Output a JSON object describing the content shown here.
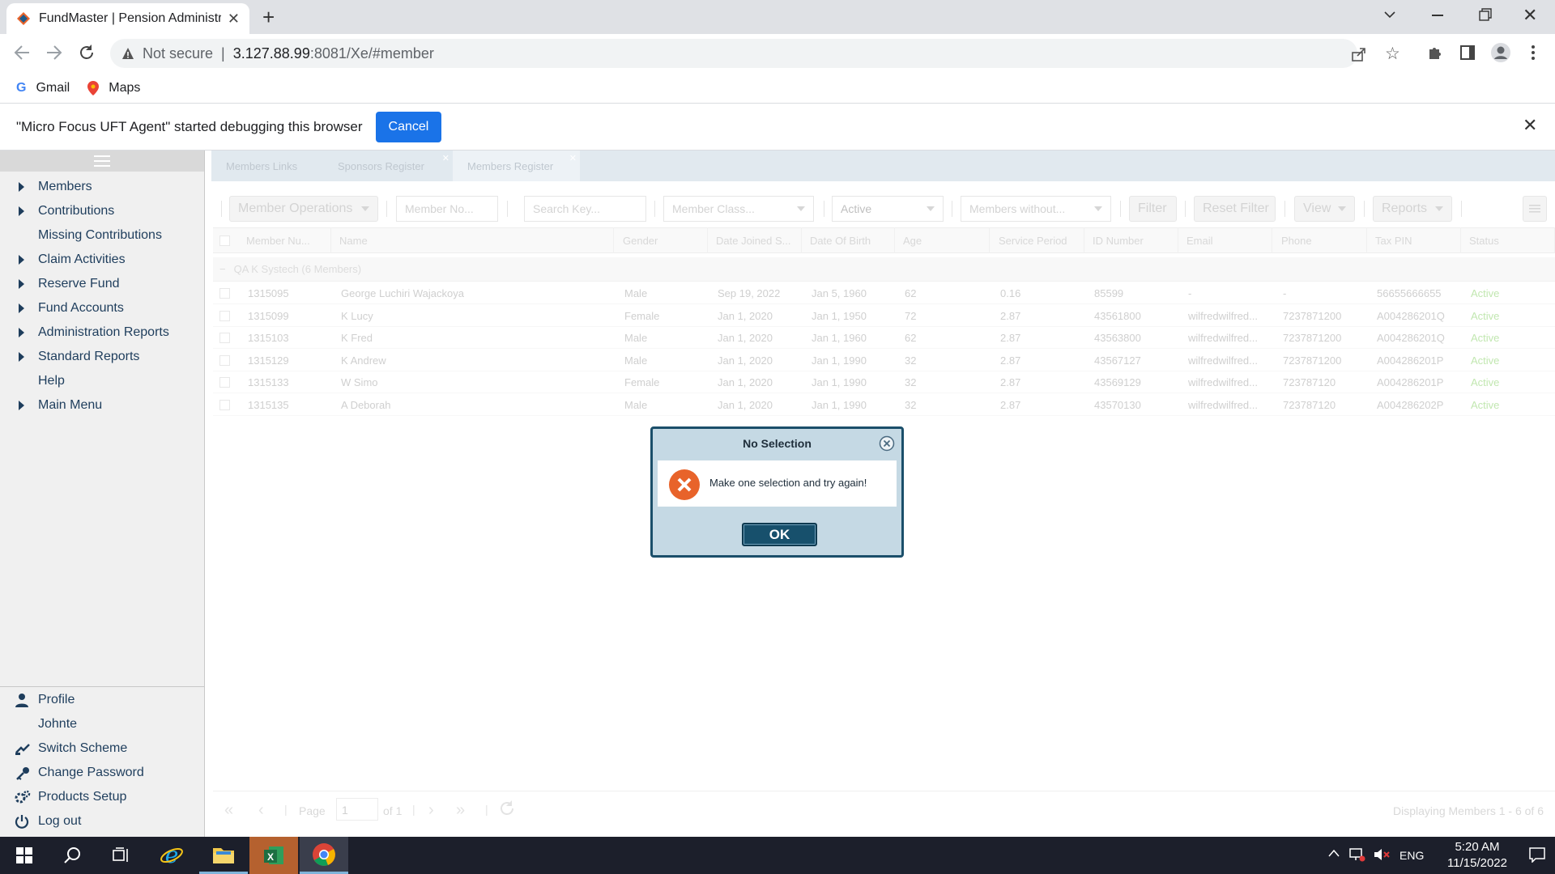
{
  "browser": {
    "tab_title": "FundMaster | Pension Administra",
    "not_secure": "Not secure",
    "url_host": "3.127.88.99",
    "url_rest": ":8081/Xe/#member",
    "bookmarks": [
      "Gmail",
      "Maps"
    ],
    "infobar_text": "\"Micro Focus UFT Agent\" started debugging this browser",
    "infobar_cancel": "Cancel"
  },
  "sidebar": {
    "items": [
      {
        "label": "Members",
        "expandable": true
      },
      {
        "label": "Contributions",
        "expandable": true
      },
      {
        "label": "Missing Contributions",
        "expandable": false
      },
      {
        "label": "Claim Activities",
        "expandable": true
      },
      {
        "label": "Reserve Fund",
        "expandable": true
      },
      {
        "label": "Fund Accounts",
        "expandable": true
      },
      {
        "label": "Administration Reports",
        "expandable": true
      },
      {
        "label": "Standard Reports",
        "expandable": true
      },
      {
        "label": "Help",
        "expandable": false
      },
      {
        "label": "Main Menu",
        "expandable": true
      }
    ],
    "bottom": {
      "profile": "Profile",
      "username": "Johnte",
      "switch_scheme": "Switch Scheme",
      "change_password": "Change Password",
      "products_setup": "Products Setup",
      "logout": "Log out"
    }
  },
  "tabs": [
    "Members Links",
    "Sponsors Register",
    "Members Register"
  ],
  "toolbar": {
    "member_operations": "Member Operations",
    "member_no_placeholder": "Member No...",
    "search_placeholder": "Search Key...",
    "member_class_placeholder": "Member Class...",
    "status_value": "Active",
    "members_without_placeholder": "Members without...",
    "filter": "Filter",
    "reset_filter": "Reset Filter",
    "view": "View",
    "reports": "Reports"
  },
  "table": {
    "columns": [
      "Member Nu...",
      "Name",
      "Gender",
      "Date Joined S...",
      "Date Of Birth",
      "Age",
      "Service Period",
      "ID Number",
      "Email",
      "Phone",
      "Tax PIN",
      "Status"
    ],
    "group_label": "QA K Systech (6 Members)",
    "rows": [
      [
        "1315095",
        "George Luchiri Wajackoya",
        "Male",
        "Sep 19, 2022",
        "Jan 5, 1960",
        "62",
        "0.16",
        "85599",
        "-",
        "-",
        "56655666655",
        "Active"
      ],
      [
        "1315099",
        "K Lucy",
        "Female",
        "Jan 1, 2020",
        "Jan 1, 1950",
        "72",
        "2.87",
        "43561800",
        "wilfredwilfred...",
        "7237871200",
        "A004286201Q",
        "Active"
      ],
      [
        "1315103",
        "K Fred",
        "Male",
        "Jan 1, 2020",
        "Jan 1, 1960",
        "62",
        "2.87",
        "43563800",
        "wilfredwilfred...",
        "7237871200",
        "A004286201Q",
        "Active"
      ],
      [
        "1315129",
        "K Andrew",
        "Male",
        "Jan 1, 2020",
        "Jan 1, 1990",
        "32",
        "2.87",
        "43567127",
        "wilfredwilfred...",
        "7237871200",
        "A004286201P",
        "Active"
      ],
      [
        "1315133",
        "W Simo",
        "Female",
        "Jan 1, 2020",
        "Jan 1, 1990",
        "32",
        "2.87",
        "43569129",
        "wilfredwilfred...",
        "723787120",
        "A004286201P",
        "Active"
      ],
      [
        "1315135",
        "A Deborah",
        "Male",
        "Jan 1, 2020",
        "Jan 1, 1990",
        "32",
        "2.87",
        "43570130",
        "wilfredwilfred...",
        "723787120",
        "A004286202P",
        "Active"
      ]
    ]
  },
  "pager": {
    "page_label": "Page",
    "page_value": "1",
    "of_label": "of 1",
    "display_text": "Displaying Members 1 - 6 of 6"
  },
  "dialog": {
    "title": "No Selection",
    "message": "Make one selection and try again!",
    "ok": "OK"
  },
  "taskbar": {
    "lang": "ENG",
    "time": "5:20 AM",
    "date": "11/15/2022"
  },
  "colors": {
    "status_active": "#8fd36f",
    "dialog_border": "#1b4f6a",
    "error_icon": "#e8632a",
    "cancel_button": "#1a73e8"
  }
}
